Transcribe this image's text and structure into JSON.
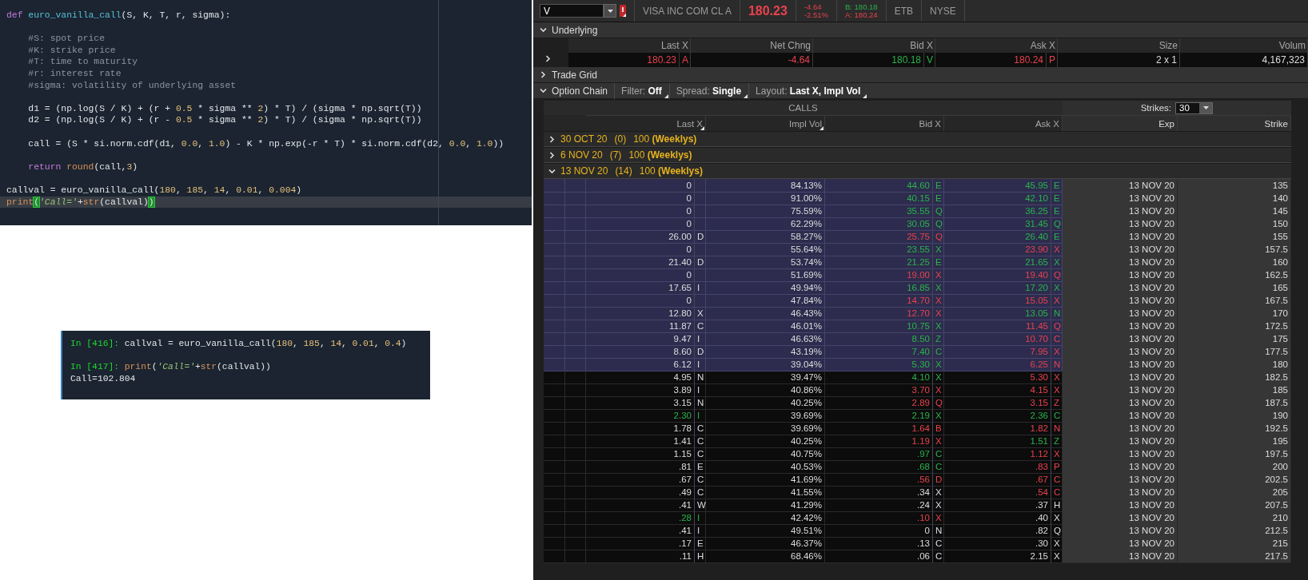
{
  "editor": {
    "lines": [
      {
        "kind": "code",
        "current": false,
        "tokens": [
          {
            "text": "def ",
            "kind": "kw"
          },
          {
            "text": "euro_vanilla_call",
            "kind": "fn"
          },
          {
            "text": "(S, K, T, r, sigma):",
            "kind": "p"
          }
        ]
      },
      {
        "kind": "blank",
        "current": false
      },
      {
        "kind": "code",
        "current": false,
        "tokens": [
          {
            "text": "    #S: spot price",
            "kind": "cm"
          }
        ]
      },
      {
        "kind": "code",
        "current": false,
        "tokens": [
          {
            "text": "    #K: strike price",
            "kind": "cm"
          }
        ]
      },
      {
        "kind": "code",
        "current": false,
        "tokens": [
          {
            "text": "    #T: time to maturity",
            "kind": "cm"
          }
        ]
      },
      {
        "kind": "code",
        "current": false,
        "tokens": [
          {
            "text": "    #r: interest rate",
            "kind": "cm"
          }
        ]
      },
      {
        "kind": "code",
        "current": false,
        "tokens": [
          {
            "text": "    #sigma: volatility of underlying asset",
            "kind": "cm"
          }
        ]
      },
      {
        "kind": "blank",
        "current": false
      },
      {
        "kind": "code",
        "current": false,
        "tokens": [
          {
            "text": "    d1 = (np.log(S / K) + (r + ",
            "kind": "p"
          },
          {
            "text": "0.5",
            "kind": "num"
          },
          {
            "text": " * sigma ** ",
            "kind": "p"
          },
          {
            "text": "2",
            "kind": "num"
          },
          {
            "text": ") * T) / (sigma * np.sqrt(T))",
            "kind": "p"
          }
        ]
      },
      {
        "kind": "code",
        "current": false,
        "tokens": [
          {
            "text": "    d2 = (np.log(S / K) + (r - ",
            "kind": "p"
          },
          {
            "text": "0.5",
            "kind": "num"
          },
          {
            "text": " * sigma ** ",
            "kind": "p"
          },
          {
            "text": "2",
            "kind": "num"
          },
          {
            "text": ") * T) / (sigma * np.sqrt(T))",
            "kind": "p"
          }
        ]
      },
      {
        "kind": "blank",
        "current": false
      },
      {
        "kind": "code",
        "current": false,
        "tokens": [
          {
            "text": "    call = (S * si.norm.cdf(d1, ",
            "kind": "p"
          },
          {
            "text": "0.0",
            "kind": "num"
          },
          {
            "text": ", ",
            "kind": "p"
          },
          {
            "text": "1.0",
            "kind": "num"
          },
          {
            "text": ") - K * np.exp(-r * T) * si.norm.cdf(d2, ",
            "kind": "p"
          },
          {
            "text": "0.0",
            "kind": "num"
          },
          {
            "text": ", ",
            "kind": "p"
          },
          {
            "text": "1.0",
            "kind": "num"
          },
          {
            "text": "))",
            "kind": "p"
          }
        ]
      },
      {
        "kind": "blank",
        "current": false
      },
      {
        "kind": "code",
        "current": false,
        "tokens": [
          {
            "text": "    return ",
            "kind": "kw"
          },
          {
            "text": "round",
            "kind": "bi"
          },
          {
            "text": "(call,",
            "kind": "p"
          },
          {
            "text": "3",
            "kind": "num"
          },
          {
            "text": ")",
            "kind": "p"
          }
        ]
      },
      {
        "kind": "blank",
        "current": false
      },
      {
        "kind": "code",
        "current": false,
        "tokens": [
          {
            "text": "callval = euro_vanilla_call(",
            "kind": "p"
          },
          {
            "text": "180",
            "kind": "num"
          },
          {
            "text": ", ",
            "kind": "p"
          },
          {
            "text": "185",
            "kind": "num"
          },
          {
            "text": ", ",
            "kind": "p"
          },
          {
            "text": "14",
            "kind": "num"
          },
          {
            "text": ", ",
            "kind": "p"
          },
          {
            "text": "0.01",
            "kind": "num"
          },
          {
            "text": ", ",
            "kind": "p"
          },
          {
            "text": "0.004",
            "kind": "num"
          },
          {
            "text": ")",
            "kind": "p"
          }
        ]
      },
      {
        "kind": "code",
        "current": true,
        "tokens": [
          {
            "text": "print",
            "kind": "bi"
          },
          {
            "text": "(",
            "kind": "match"
          },
          {
            "text": "'Call='",
            "kind": "str"
          },
          {
            "text": "+",
            "kind": "p"
          },
          {
            "text": "str",
            "kind": "bi"
          },
          {
            "text": "(callval)",
            "kind": "p"
          },
          {
            "text": ")",
            "kind": "match"
          }
        ]
      }
    ]
  },
  "console": {
    "lines": [
      {
        "kind": "input",
        "prompt": "In [416]: ",
        "tokens": [
          {
            "text": "callval = euro_vanilla_call(",
            "kind": "p"
          },
          {
            "text": "180",
            "kind": "num"
          },
          {
            "text": ", ",
            "kind": "p"
          },
          {
            "text": "185",
            "kind": "num"
          },
          {
            "text": ", ",
            "kind": "p"
          },
          {
            "text": "14",
            "kind": "num"
          },
          {
            "text": ", ",
            "kind": "p"
          },
          {
            "text": "0.01",
            "kind": "num"
          },
          {
            "text": ", ",
            "kind": "p"
          },
          {
            "text": "0.4",
            "kind": "num"
          },
          {
            "text": ")",
            "kind": "p"
          }
        ]
      },
      {
        "kind": "blank"
      },
      {
        "kind": "input",
        "prompt": "In [417]: ",
        "tokens": [
          {
            "text": "print",
            "kind": "bi"
          },
          {
            "text": "(",
            "kind": "p"
          },
          {
            "text": "'Call='",
            "kind": "str"
          },
          {
            "text": "+",
            "kind": "p"
          },
          {
            "text": "str",
            "kind": "bi"
          },
          {
            "text": "(callval))",
            "kind": "p"
          }
        ]
      },
      {
        "kind": "output",
        "text": "Call=102.804"
      }
    ]
  },
  "quote": {
    "symbol": "V",
    "company": "VISA INC COM CL A",
    "last": "180.23",
    "net_change": "-4.64",
    "percent_change": "-2.51%",
    "bid": "B: 180.18",
    "ask": "A: 180.24",
    "badges": [
      "ETB",
      "NYSE"
    ]
  },
  "underlying": {
    "title": "Underlying",
    "expanded": true,
    "columns": [
      "Last X",
      "Net Chng",
      "Bid X",
      "Ask X",
      "Size",
      "Volum"
    ],
    "values": [
      {
        "value": "180.23",
        "exchange": "A",
        "color": "#e8424d"
      },
      {
        "value": "-4.64",
        "color": "#e8424d"
      },
      {
        "value": "180.18",
        "exchange": "V",
        "color": "#2bb34b"
      },
      {
        "value": "180.24",
        "exchange": "P",
        "color": "#e8424d"
      },
      {
        "value": "2 x 1"
      },
      {
        "value": "4,167,323"
      }
    ]
  },
  "trade_grid": {
    "title": "Trade Grid",
    "expanded": false
  },
  "option_chain": {
    "title": "Option Chain",
    "expanded": true,
    "controls": [
      "Filter: **Off**",
      "Spread: **Single**",
      "Layout: **Last X, Impl Vol**"
    ],
    "side": "CALLS",
    "strikes_label": "Strikes:",
    "strikes": "30",
    "columns": [
      {
        "label": "Last X",
        "menu": true
      },
      {
        "label": "Impl Vol",
        "menu": true
      },
      {
        "label": "Bid X",
        "menu": false
      },
      {
        "label": "Ask X",
        "menu": false
      },
      {
        "label": "Exp",
        "menu": false
      },
      {
        "label": "Strike",
        "menu": false
      }
    ],
    "expiry_groups": [
      {
        "date": "30 OCT 20",
        "days": "(0)",
        "multiplier": "100 **(Weeklys)**",
        "expanded": false
      },
      {
        "date": "6 NOV 20",
        "days": "(7)",
        "multiplier": "100 **(Weeklys)**",
        "expanded": false
      },
      {
        "date": "13 NOV 20",
        "days": "(14)",
        "multiplier": "100 **(Weeklys)**",
        "expanded": true,
        "rows": [
          {
            "in_the_money": true,
            "last": {
              "value": "0"
            },
            "iv": "84.13%",
            "bid": {
              "value": "44.60",
              "exchange": "E",
              "color": "#2bb34b"
            },
            "ask": {
              "value": "45.95",
              "exchange": "E",
              "color": "#2bb34b"
            },
            "exp": "13 NOV 20",
            "strike": "135"
          },
          {
            "in_the_money": true,
            "last": {
              "value": "0"
            },
            "iv": "91.00%",
            "bid": {
              "value": "40.15",
              "exchange": "E",
              "color": "#2bb34b"
            },
            "ask": {
              "value": "42.10",
              "exchange": "E",
              "color": "#2bb34b"
            },
            "exp": "13 NOV 20",
            "strike": "140"
          },
          {
            "in_the_money": true,
            "last": {
              "value": "0"
            },
            "iv": "75.59%",
            "bid": {
              "value": "35.55",
              "exchange": "Q",
              "color": "#2bb34b"
            },
            "ask": {
              "value": "36.25",
              "exchange": "E",
              "color": "#2bb34b"
            },
            "exp": "13 NOV 20",
            "strike": "145"
          },
          {
            "in_the_money": true,
            "last": {
              "value": "0"
            },
            "iv": "62.29%",
            "bid": {
              "value": "30.05",
              "exchange": "Q",
              "color": "#2bb34b"
            },
            "ask": {
              "value": "31.45",
              "exchange": "Q",
              "color": "#2bb34b"
            },
            "exp": "13 NOV 20",
            "strike": "150"
          },
          {
            "in_the_money": true,
            "last": {
              "value": "26.00",
              "exchange": "D"
            },
            "iv": "58.27%",
            "bid": {
              "value": "25.75",
              "exchange": "Q",
              "color": "#e8424d"
            },
            "ask": {
              "value": "26.40",
              "exchange": "E",
              "color": "#2bb34b"
            },
            "exp": "13 NOV 20",
            "strike": "155"
          },
          {
            "in_the_money": true,
            "last": {
              "value": "0"
            },
            "iv": "55.64%",
            "bid": {
              "value": "23.55",
              "exchange": "X",
              "color": "#2bb34b"
            },
            "ask": {
              "value": "23.90",
              "exchange": "X",
              "color": "#e8424d"
            },
            "exp": "13 NOV 20",
            "strike": "157.5"
          },
          {
            "in_the_money": true,
            "last": {
              "value": "21.40",
              "exchange": "D"
            },
            "iv": "53.74%",
            "bid": {
              "value": "21.25",
              "exchange": "E",
              "color": "#2bb34b"
            },
            "ask": {
              "value": "21.65",
              "exchange": "X",
              "color": "#2bb34b"
            },
            "exp": "13 NOV 20",
            "strike": "160"
          },
          {
            "in_the_money": true,
            "last": {
              "value": "0"
            },
            "iv": "51.69%",
            "bid": {
              "value": "19.00",
              "exchange": "X",
              "color": "#e8424d"
            },
            "ask": {
              "value": "19.40",
              "exchange": "Q",
              "color": "#e8424d"
            },
            "exp": "13 NOV 20",
            "strike": "162.5"
          },
          {
            "in_the_money": true,
            "last": {
              "value": "17.65",
              "exchange": "I"
            },
            "iv": "49.94%",
            "bid": {
              "value": "16.85",
              "exchange": "X",
              "color": "#2bb34b"
            },
            "ask": {
              "value": "17.20",
              "exchange": "X",
              "color": "#2bb34b"
            },
            "exp": "13 NOV 20",
            "strike": "165"
          },
          {
            "in_the_money": true,
            "last": {
              "value": "0"
            },
            "iv": "47.84%",
            "bid": {
              "value": "14.70",
              "exchange": "X",
              "color": "#e8424d"
            },
            "ask": {
              "value": "15.05",
              "exchange": "X",
              "color": "#e8424d"
            },
            "exp": "13 NOV 20",
            "strike": "167.5"
          },
          {
            "in_the_money": true,
            "last": {
              "value": "12.80",
              "exchange": "X"
            },
            "iv": "46.43%",
            "bid": {
              "value": "12.70",
              "exchange": "X",
              "color": "#e8424d"
            },
            "ask": {
              "value": "13.05",
              "exchange": "N",
              "color": "#2bb34b"
            },
            "exp": "13 NOV 20",
            "strike": "170"
          },
          {
            "in_the_money": true,
            "last": {
              "value": "11.87",
              "exchange": "C"
            },
            "iv": "46.01%",
            "bid": {
              "value": "10.75",
              "exchange": "X",
              "color": "#2bb34b"
            },
            "ask": {
              "value": "11.45",
              "exchange": "Q",
              "color": "#e8424d"
            },
            "exp": "13 NOV 20",
            "strike": "172.5"
          },
          {
            "in_the_money": true,
            "last": {
              "value": "9.47",
              "exchange": "I"
            },
            "iv": "46.63%",
            "bid": {
              "value": "8.50",
              "exchange": "Z",
              "color": "#2bb34b"
            },
            "ask": {
              "value": "10.70",
              "exchange": "C",
              "color": "#e8424d"
            },
            "exp": "13 NOV 20",
            "strike": "175"
          },
          {
            "in_the_money": true,
            "last": {
              "value": "8.60",
              "exchange": "D"
            },
            "iv": "43.19%",
            "bid": {
              "value": "7.40",
              "exchange": "C",
              "color": "#2bb34b"
            },
            "ask": {
              "value": "7.95",
              "exchange": "X",
              "color": "#e8424d"
            },
            "exp": "13 NOV 20",
            "strike": "177.5"
          },
          {
            "in_the_money": true,
            "last": {
              "value": "6.12",
              "exchange": "I"
            },
            "iv": "39.04%",
            "bid": {
              "value": "5.30",
              "exchange": "X",
              "color": "#2bb34b"
            },
            "ask": {
              "value": "6.25",
              "exchange": "N",
              "color": "#e8424d"
            },
            "exp": "13 NOV 20",
            "strike": "180"
          },
          {
            "in_the_money": false,
            "last": {
              "value": "4.95",
              "exchange": "N"
            },
            "iv": "39.47%",
            "bid": {
              "value": "4.10",
              "exchange": "X",
              "color": "#2bb34b"
            },
            "ask": {
              "value": "5.30",
              "exchange": "X",
              "color": "#e8424d"
            },
            "exp": "13 NOV 20",
            "strike": "182.5"
          },
          {
            "in_the_money": false,
            "last": {
              "value": "3.89",
              "exchange": "I"
            },
            "iv": "40.86%",
            "bid": {
              "value": "3.70",
              "exchange": "X",
              "color": "#e8424d"
            },
            "ask": {
              "value": "4.15",
              "exchange": "X",
              "color": "#e8424d"
            },
            "exp": "13 NOV 20",
            "strike": "185"
          },
          {
            "in_the_money": false,
            "last": {
              "value": "3.15",
              "exchange": "N"
            },
            "iv": "40.25%",
            "bid": {
              "value": "2.89",
              "exchange": "Q",
              "color": "#e8424d"
            },
            "ask": {
              "value": "3.15",
              "exchange": "Z",
              "color": "#e8424d"
            },
            "exp": "13 NOV 20",
            "strike": "187.5"
          },
          {
            "in_the_money": false,
            "last": {
              "value": "2.30",
              "exchange": "I",
              "color": "#2bb34b"
            },
            "iv": "39.69%",
            "bid": {
              "value": "2.19",
              "exchange": "X",
              "color": "#2bb34b"
            },
            "ask": {
              "value": "2.36",
              "exchange": "C",
              "color": "#2bb34b"
            },
            "exp": "13 NOV 20",
            "strike": "190"
          },
          {
            "in_the_money": false,
            "last": {
              "value": "1.78",
              "exchange": "C"
            },
            "iv": "39.69%",
            "bid": {
              "value": "1.64",
              "exchange": "B",
              "color": "#e8424d"
            },
            "ask": {
              "value": "1.82",
              "exchange": "N",
              "color": "#e8424d"
            },
            "exp": "13 NOV 20",
            "strike": "192.5"
          },
          {
            "in_the_money": false,
            "last": {
              "value": "1.41",
              "exchange": "C"
            },
            "iv": "40.25%",
            "bid": {
              "value": "1.19",
              "exchange": "X",
              "color": "#e8424d"
            },
            "ask": {
              "value": "1.51",
              "exchange": "Z",
              "color": "#2bb34b"
            },
            "exp": "13 NOV 20",
            "strike": "195"
          },
          {
            "in_the_money": false,
            "last": {
              "value": "1.15",
              "exchange": "C"
            },
            "iv": "40.75%",
            "bid": {
              "value": ".97",
              "exchange": "C",
              "color": "#2bb34b"
            },
            "ask": {
              "value": "1.12",
              "exchange": "X",
              "color": "#e8424d"
            },
            "exp": "13 NOV 20",
            "strike": "197.5"
          },
          {
            "in_the_money": false,
            "last": {
              "value": ".81",
              "exchange": "E"
            },
            "iv": "40.53%",
            "bid": {
              "value": ".68",
              "exchange": "C",
              "color": "#2bb34b"
            },
            "ask": {
              "value": ".83",
              "exchange": "P",
              "color": "#e8424d"
            },
            "exp": "13 NOV 20",
            "strike": "200"
          },
          {
            "in_the_money": false,
            "last": {
              "value": ".67",
              "exchange": "C"
            },
            "iv": "41.69%",
            "bid": {
              "value": ".56",
              "exchange": "D",
              "color": "#e8424d"
            },
            "ask": {
              "value": ".67",
              "exchange": "C",
              "color": "#e8424d"
            },
            "exp": "13 NOV 20",
            "strike": "202.5"
          },
          {
            "in_the_money": false,
            "last": {
              "value": ".49",
              "exchange": "C"
            },
            "iv": "41.55%",
            "bid": {
              "value": ".34",
              "exchange": "X"
            },
            "ask": {
              "value": ".54",
              "exchange": "C",
              "color": "#e8424d"
            },
            "exp": "13 NOV 20",
            "strike": "205"
          },
          {
            "in_the_money": false,
            "last": {
              "value": ".41",
              "exchange": "W"
            },
            "iv": "41.29%",
            "bid": {
              "value": ".24",
              "exchange": "X"
            },
            "ask": {
              "value": ".37",
              "exchange": "H"
            },
            "exp": "13 NOV 20",
            "strike": "207.5"
          },
          {
            "in_the_money": false,
            "last": {
              "value": ".28",
              "exchange": "I",
              "color": "#2bb34b"
            },
            "iv": "42.42%",
            "bid": {
              "value": ".10",
              "exchange": "X",
              "color": "#e8424d"
            },
            "ask": {
              "value": ".40",
              "exchange": "X"
            },
            "exp": "13 NOV 20",
            "strike": "210"
          },
          {
            "in_the_money": false,
            "last": {
              "value": ".41",
              "exchange": "I"
            },
            "iv": "49.51%",
            "bid": {
              "value": "0",
              "exchange": "N"
            },
            "ask": {
              "value": ".82",
              "exchange": "Q"
            },
            "exp": "13 NOV 20",
            "strike": "212.5"
          },
          {
            "in_the_money": false,
            "last": {
              "value": ".17",
              "exchange": "E"
            },
            "iv": "46.37%",
            "bid": {
              "value": ".13",
              "exchange": "C"
            },
            "ask": {
              "value": ".30",
              "exchange": "X"
            },
            "exp": "13 NOV 20",
            "strike": "215"
          },
          {
            "in_the_money": false,
            "last": {
              "value": ".11",
              "exchange": "H"
            },
            "iv": "68.46%",
            "bid": {
              "value": ".06",
              "exchange": "C"
            },
            "ask": {
              "value": "2.15",
              "exchange": "X"
            },
            "exp": "13 NOV 20",
            "strike": "217.5"
          }
        ]
      }
    ]
  }
}
